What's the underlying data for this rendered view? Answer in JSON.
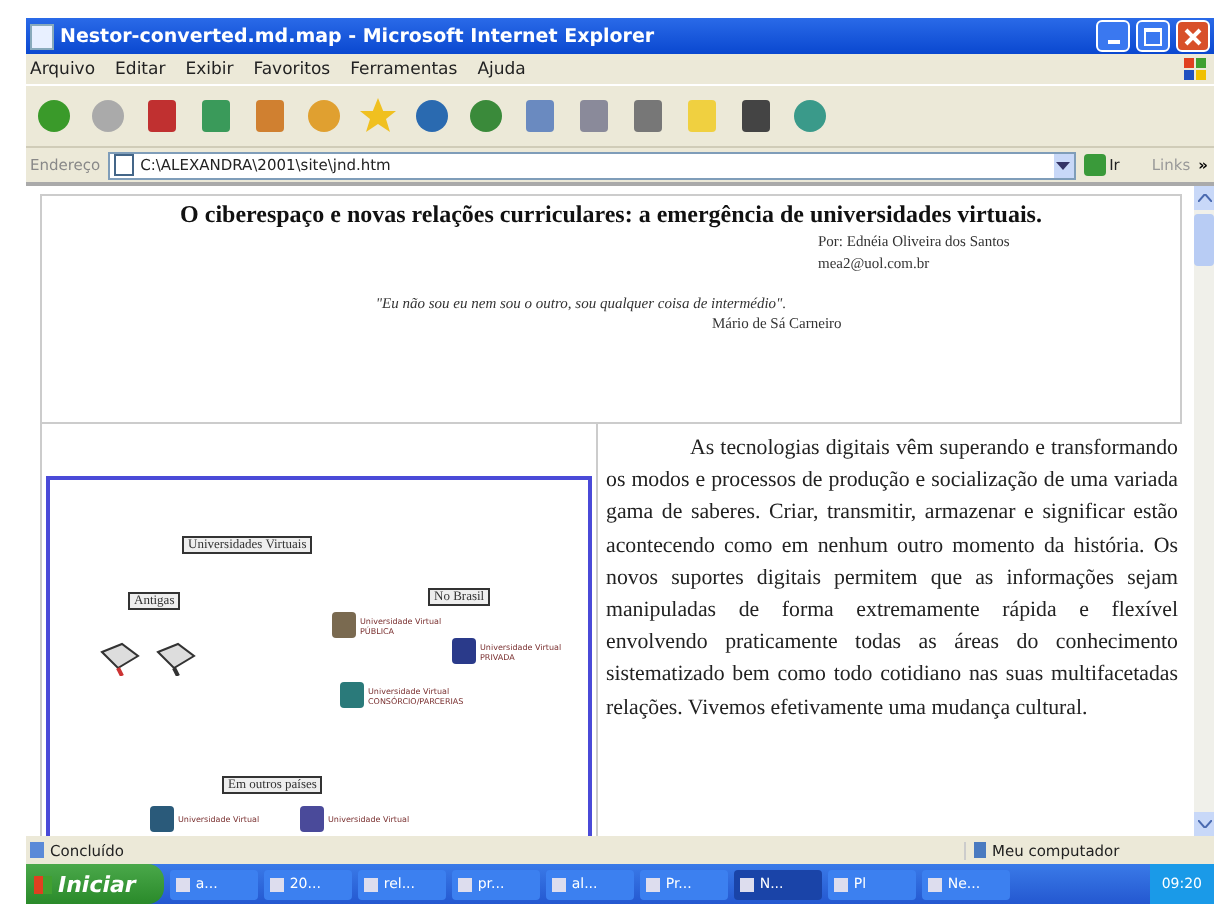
{
  "window": {
    "title": "Nestor-converted.md.map - Microsoft Internet Explorer"
  },
  "menu": [
    "Arquivo",
    "Editar",
    "Exibir",
    "Favoritos",
    "Ferramentas",
    "Ajuda"
  ],
  "address": {
    "label": "Endereço",
    "value": "C:\\ALEXANDRA\\2001\\site\\jnd.htm",
    "go": "Ir",
    "links": "Links",
    "more": "»"
  },
  "document": {
    "title": "O ciberespaço e novas relações curriculares: a emergência de universidades virtuais.",
    "author": "Por: Ednéia Oliveira dos Santos",
    "email": "mea2@uol.com.br",
    "quote": "\"Eu não sou eu nem sou o outro, sou qualquer coisa de intermédio\".",
    "quote_author": "Mário de Sá Carneiro",
    "diagram": [
      {
        "kind": "label",
        "text": "Universidades Virtuais"
      },
      {
        "kind": "label",
        "text": "Antigas"
      },
      {
        "kind": "label",
        "text": "No Brasil"
      },
      {
        "kind": "books"
      },
      {
        "kind": "logo",
        "text": "Universidade Virtual PÚBLICA",
        "color": "#7a6a50"
      },
      {
        "kind": "logo",
        "text": "Universidade Virtual PRIVADA",
        "color": "#2a3a8a"
      },
      {
        "kind": "logo",
        "text": "Universidade Virtual CONSÓRCIO/PARCERIAS",
        "color": "#2a7a7a"
      },
      {
        "kind": "label",
        "text": "Em outros países"
      },
      {
        "kind": "logo",
        "text": "Universidade Virtual",
        "color": "#2a5a7a"
      },
      {
        "kind": "logo",
        "text": "Universidade Virtual",
        "color": "#4a4a9a"
      }
    ],
    "paragraph": "As tecnologias digitais vêm superando e transformando os modos e processos de produção e socialização de uma variada gama de saberes. Criar, transmitir, armazenar e significar estão acontecendo como em nenhum outro momento da história. Os novos suportes digitais permitem que as informações sejam manipuladas de forma extremamente rápida e flexível envolvendo praticamente todas as áreas do conhecimento sistematizado bem como todo cotidiano nas suas multifacetadas relações. Vivemos efetivamente uma mudança cultural."
  },
  "status_bar": {
    "text": "Concluído",
    "zone": "Meu computador"
  },
  "taskbar": {
    "start": "Iniciar",
    "items": [
      {
        "label": "a...",
        "selected": false
      },
      {
        "label": "20...",
        "selected": false
      },
      {
        "label": "rel...",
        "selected": false
      },
      {
        "label": "pr...",
        "selected": false
      },
      {
        "label": "al...",
        "selected": false
      },
      {
        "label": "Pr...",
        "selected": false
      },
      {
        "label": "N...",
        "selected": true
      },
      {
        "label": "Pl",
        "selected": false
      },
      {
        "label": "Ne...",
        "selected": false
      }
    ],
    "clock": "09:20"
  }
}
